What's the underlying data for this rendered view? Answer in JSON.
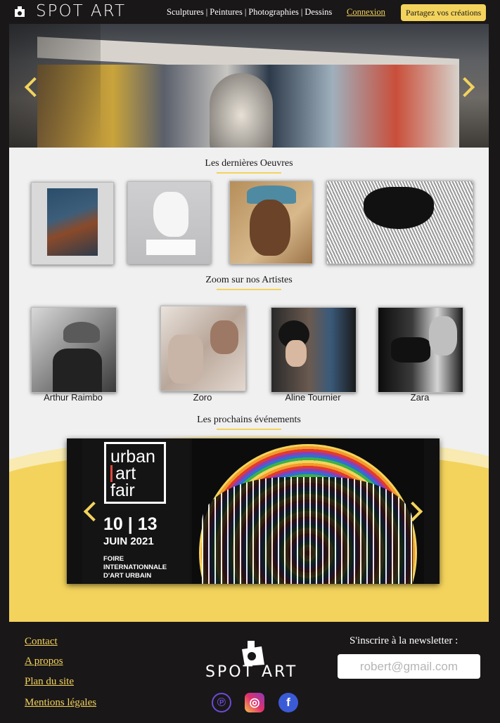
{
  "header": {
    "logo_text": "SPOT ART",
    "nav": [
      "Sculptures",
      "Peintures",
      "Photographies",
      "Dessins"
    ],
    "separator": "|",
    "login": "Connexion",
    "share": "Partagez vos créations"
  },
  "sections": {
    "latest": "Les dernières Oeuvres",
    "artists": "Zoom sur nos Artistes",
    "events": "Les prochains événements"
  },
  "artists": [
    "Arthur Raimbo",
    "Zoro",
    "Aline Tournier",
    "Zara"
  ],
  "event": {
    "logo_lines": [
      "urban",
      "art",
      "fair"
    ],
    "dates": "10 | 13",
    "month": "JUIN 2021",
    "desc": [
      "FOIRE",
      "INTERNATIONNALE",
      "D'ART URBAIN"
    ]
  },
  "footer": {
    "links": [
      "Contact",
      "A propos",
      "Plan du site",
      "Mentions légales"
    ],
    "logo_text": "SPOT ART",
    "newsletter_label": "S'inscrire à la newsletter :",
    "newsletter_placeholder": "robert@gmail.com",
    "social": [
      {
        "icon": "pinterest-icon",
        "glyph": "℗",
        "color": "#6b4bd8"
      },
      {
        "icon": "instagram-icon",
        "glyph": "◎",
        "color": "#e1306c"
      },
      {
        "icon": "facebook-icon",
        "glyph": "f",
        "color": "#3b5bd6"
      }
    ]
  },
  "colors": {
    "accent": "#f3d35c",
    "dark": "#1a1718",
    "background": "#f0f0f0"
  }
}
